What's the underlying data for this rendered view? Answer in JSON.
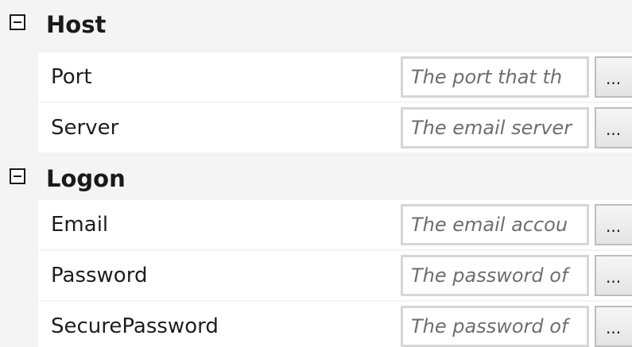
{
  "categories": [
    {
      "label": "Host",
      "properties": [
        {
          "name": "Port",
          "placeholder": "The port that th",
          "button_label": "..."
        },
        {
          "name": "Server",
          "placeholder": "The email server",
          "button_label": "..."
        }
      ]
    },
    {
      "label": "Logon",
      "properties": [
        {
          "name": "Email",
          "placeholder": "The email accou",
          "button_label": "..."
        },
        {
          "name": "Password",
          "placeholder": "The password of",
          "button_label": "..."
        },
        {
          "name": "SecurePassword",
          "placeholder": "The password of",
          "button_label": "..."
        }
      ]
    }
  ],
  "icons": {
    "expander": "collapse-minus-icon"
  }
}
